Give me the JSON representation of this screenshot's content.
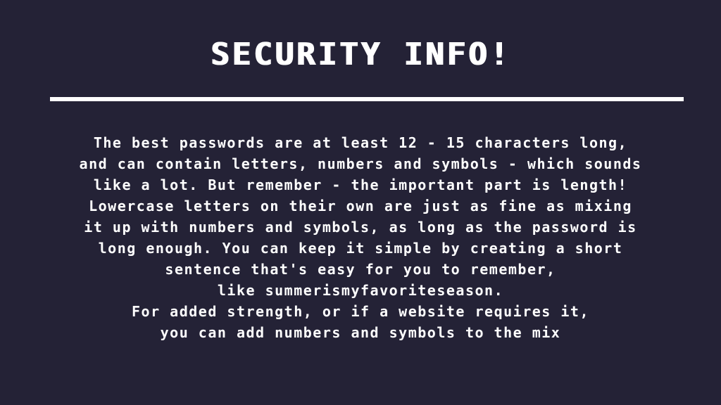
{
  "title": "SECURITY INFO!",
  "colors": {
    "background": "#242236",
    "text": "#ffffff",
    "divider": "#ffffff"
  },
  "body_lines": [
    "The best passwords are at least 12 - 15 characters long,",
    "and can contain letters, numbers and symbols - which sounds",
    "like a lot. But remember - the important part is length!",
    "Lowercase letters on their own are just as fine as mixing",
    "it up with numbers and symbols, as long as the password is",
    "long enough. You can keep it simple by creating a short",
    "sentence that's easy for you to remember,",
    "like summerismyfavoriteseason.",
    "For added strength, or if a website requires it,",
    "you can add numbers and symbols to the mix"
  ]
}
